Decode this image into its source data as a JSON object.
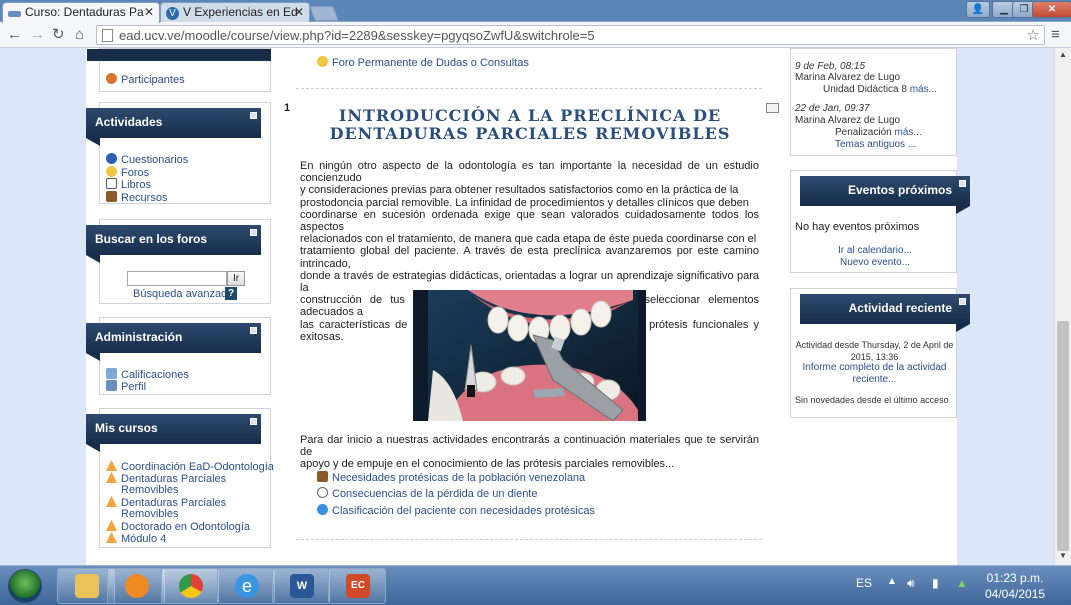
{
  "browser": {
    "tabs": [
      {
        "title": "Curso: Dentaduras Pa",
        "active": true
      },
      {
        "title": "V Experiencias en Ed",
        "active": false
      }
    ],
    "url": "ead.ucv.ve/moodle/course/view.php?id=2289&sesskey=pgyqsoZwfU&switchrole=5"
  },
  "left": {
    "participants": "Participantes",
    "activities": {
      "title": "Actividades",
      "items": [
        "Cuestionarios",
        "Foros",
        "Libros",
        "Recursos"
      ]
    },
    "search": {
      "title": "Buscar en los foros",
      "button": "Ir",
      "advanced": "Búsqueda avanzada",
      "help": "?"
    },
    "admin": {
      "title": "Administración",
      "items": [
        "Calificaciones",
        "Perfil"
      ]
    },
    "courses": {
      "title": "Mis cursos",
      "items": [
        "Coordinación EaD-Odontología",
        "Dentaduras Parciales",
        "Removibles",
        "Dentaduras Parciales",
        "Removibles",
        "Doctorado en Odontología",
        "Módulo 4"
      ]
    }
  },
  "center": {
    "forum_top": "Foro Permanente de Dudas o Consultas",
    "section_number": "1",
    "title_line1": "INTRODUCCIÓN A LA PRECLÍNICA DE",
    "title_line2": "DENTADURAS PARCIALES REMOVIBLES",
    "paragraph1_lines": [
      "En ningún otro aspecto de la odontología es tan importante la necesidad de un estudio concienzudo",
      "y consideraciones previas para obtener resultados satisfactorios como en la práctica de la",
      "prostodoncia parcial removible. La infinidad de procedimientos y detalles clínicos que deben",
      "coordinarse en sucesión ordenada exige que sean valorados cuidadosamente todos los aspectos",
      "relacionados con el tratamiento, de manera que cada etapa de éste pueda coordinarse con el",
      "tratamiento global del paciente. A través de esta preclínica avanzaremos por este camino intrincado,",
      "donde a través de estrategias didácticas, orientadas a lograr un aprendizaje significativo para la",
      "construcción de tus aprendizajes, lograrás comprender que al seleccionar elementos adecuados a",
      "las características de cada paciente, podrás diseñar y confeccionar prótesis funcionales y exitosas."
    ],
    "paragraph2_lines": [
      "Para dar inicio a nuestras actividades encontrarás a continuación materiales que te servirán de",
      "apoyo y de empuje en el conocimiento de las prótesis parciales removibles..."
    ],
    "resources": [
      "Necesidades protésicas de la población venezolana",
      "Consecuencias de la pérdida de un diente",
      "Clasificación del paciente con necesidades protésicas"
    ]
  },
  "right": {
    "news": [
      {
        "date": "9 de Feb, 08:15",
        "author": "Marina Alvarez de Lugo",
        "text": "Unidad Didáctica 8",
        "more": "más..."
      },
      {
        "date": "22 de Jan, 09:37",
        "author": "Marina Alvarez de Lugo",
        "text": "Penalización",
        "more": "más..."
      }
    ],
    "older": "Temas antiguos ...",
    "events": {
      "title": "Eventos próximos",
      "none": "No hay eventos próximos",
      "calendar": "Ir al calendario...",
      "new": "Nuevo evento..."
    },
    "recent": {
      "title": "Actividad reciente",
      "since_line1": "Actividad desde Thursday, 2 de April de",
      "since_line2": "2015, 13:36",
      "report_line1": "Informe completo de la actividad",
      "report_line2": "reciente...",
      "nothing": "Sin novedades desde el último acceso"
    }
  },
  "taskbar": {
    "lang": "ES",
    "time": "01:23 p.m.",
    "date": "04/04/2015"
  },
  "colors": {
    "header": "#1f3a5f",
    "link": "#2b4f8c",
    "title": "#2a4e7d"
  }
}
